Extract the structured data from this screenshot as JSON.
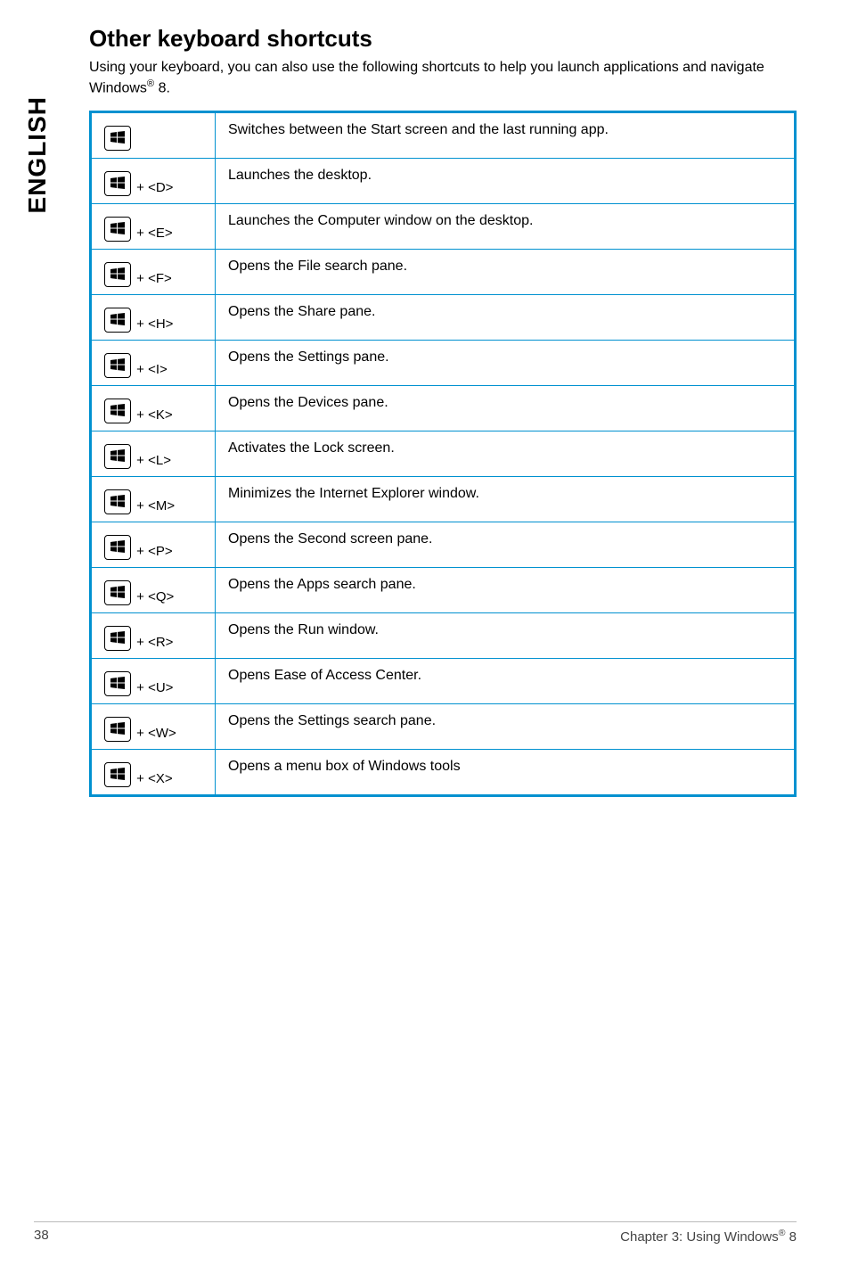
{
  "sidebar_label": "ENGLISH",
  "title": "Other keyboard shortcuts",
  "intro_prefix": "Using your keyboard, you can also use the following shortcuts to help you launch applications and navigate Windows",
  "intro_suffix": " 8.",
  "rows": [
    {
      "key": "",
      "desc": "Switches between the Start screen and the last running app."
    },
    {
      "key": " + <D>",
      "desc": "Launches the desktop."
    },
    {
      "key": " + <E>",
      "desc": "Launches the Computer window on the desktop."
    },
    {
      "key": " + <F>",
      "desc": "Opens the File search pane."
    },
    {
      "key": " + <H>",
      "desc": "Opens the Share pane."
    },
    {
      "key": " + <I>",
      "desc": "Opens the Settings pane."
    },
    {
      "key": " + <K>",
      "desc": "Opens the Devices pane."
    },
    {
      "key": " + <L>",
      "desc": "Activates the Lock screen."
    },
    {
      "key": " + <M>",
      "desc": "Minimizes the Internet Explorer window."
    },
    {
      "key": " + <P>",
      "desc": "Opens the Second screen pane."
    },
    {
      "key": " + <Q>",
      "desc": "Opens the Apps search pane."
    },
    {
      "key": " + <R>",
      "desc": "Opens the Run window."
    },
    {
      "key": " + <U>",
      "desc": "Opens Ease of Access Center."
    },
    {
      "key": " + <W>",
      "desc": "Opens the Settings search pane."
    },
    {
      "key": " + <X>",
      "desc": "Opens a menu box of Windows tools"
    }
  ],
  "footer_page": "38",
  "footer_chapter_prefix": "Chapter 3: Using Windows",
  "footer_chapter_suffix": " 8"
}
